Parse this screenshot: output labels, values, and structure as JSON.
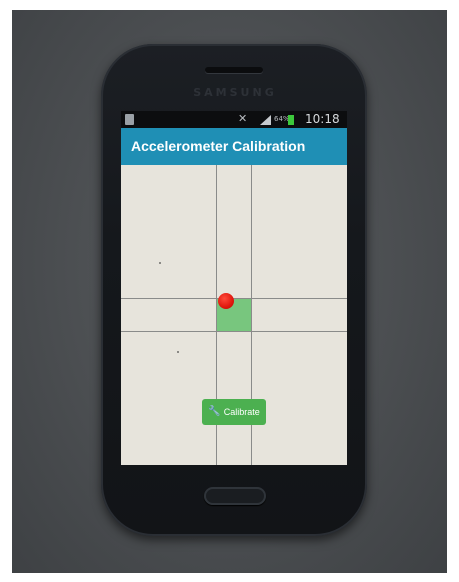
{
  "device": {
    "brand": "SAMSUNG"
  },
  "status_bar": {
    "battery_percent": "64%",
    "time": "10:18",
    "icons": [
      "sim-icon",
      "mute-icon",
      "signal-icon",
      "battery-icon"
    ],
    "battery_color": "#3cc83c"
  },
  "app": {
    "title": "Accelerometer Calibration",
    "accent_color": "#1f8fb5"
  },
  "calibration_view": {
    "background_color": "#e7e4dc",
    "target_color": "#78c67e",
    "ball_color": "#e0180e",
    "calibrate_button": {
      "icon": "wrench-icon",
      "label": "Calibrate",
      "color": "#4cb050"
    }
  }
}
